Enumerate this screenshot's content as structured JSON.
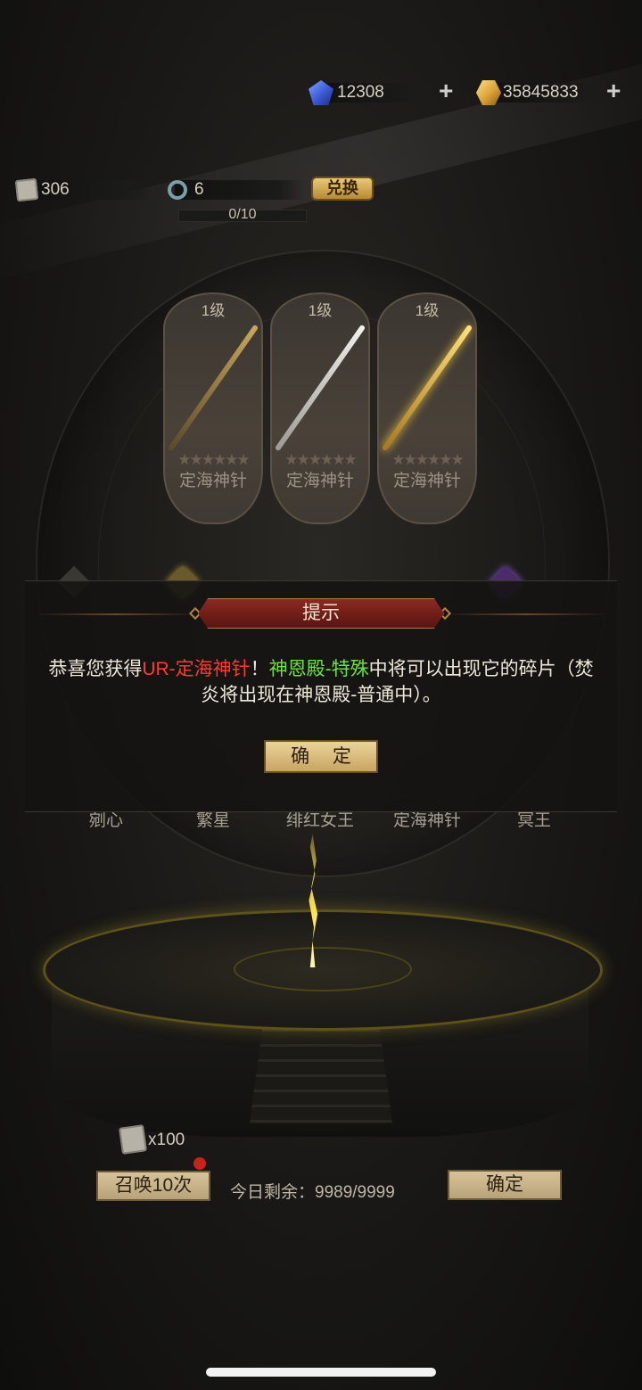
{
  "currencies": {
    "diamond": {
      "value": "12308",
      "icon": "blue-gem-icon"
    },
    "gold": {
      "value": "35845833",
      "icon": "gold-gem-icon"
    },
    "plus_symbol": "+"
  },
  "resources": {
    "scroll_count": "306",
    "ring_count": "6",
    "exchange_label": "兑换",
    "progress_text": "0/10",
    "progress_fraction": 0
  },
  "cards": [
    {
      "level": "1级",
      "stars": "★★★★★★",
      "name": "定海神针"
    },
    {
      "level": "1级",
      "stars": "★★★★★★",
      "name": "定海神针"
    },
    {
      "level": "1级",
      "stars": "★★★★★★",
      "name": "定海神针"
    }
  ],
  "heroes": [
    "剜心",
    "繁星",
    "绯红女王",
    "定海神针",
    "冥王"
  ],
  "dialog": {
    "title": "提示",
    "msg_prefix": "恭喜您获得",
    "msg_item": "UR-定海神针",
    "msg_mid": "！",
    "msg_location": "神恩殿-特殊",
    "msg_suffix": "中将可以出现它的碎片（焚炎将出现在神恩殿-普通中）。",
    "confirm_label": "确 定"
  },
  "bottom": {
    "cost_text": "x100",
    "summon_label": "召唤10次",
    "remaining_text": "今日剩余：9989/9999",
    "confirm_label": "确定"
  },
  "colors": {
    "highlight_red": "#ff3a2e",
    "highlight_green": "#6ee33b",
    "gold_accent": "#c9a562"
  }
}
